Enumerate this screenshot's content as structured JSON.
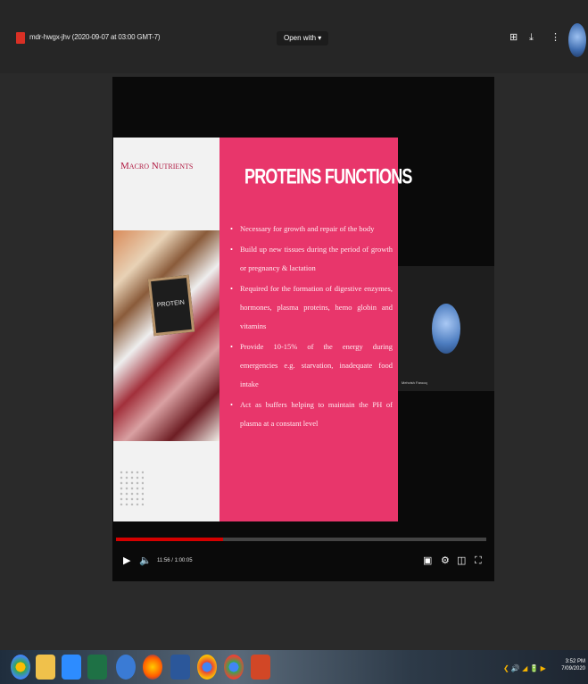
{
  "viewer": {
    "file_title": "mdr-hwgx-jhv (2020-09-07 at 03:00 GMT-7)",
    "open_with_label": "Open with ▾",
    "icons": [
      "add-to-drive-icon",
      "download-icon",
      "more-vert-icon"
    ]
  },
  "slide": {
    "left_title": "Macro Nutrients",
    "photo_sign_text": "PROTEIN",
    "heading": "PROTEINS FUNCTIONS",
    "bullets": [
      "Necessary for growth and repair of the body",
      "Build up new tissues during the period of growth or pregnancy & lactation",
      "Required for the formation of digestive enzymes, hormones, plasma proteins, hemo globin and vitamins",
      "Provide 10-15% of the energy during emergencies e.g. starvation, inadequate food intake",
      "Act as buffers helping to maintain the PH of plasma at a constant level"
    ],
    "colors": {
      "accent": "#e8366b",
      "title": "#b01a42"
    }
  },
  "participant": {
    "name": "Mehvish Farooq"
  },
  "player": {
    "progress_fraction": 0.29,
    "time": "11:56 / 1:00:05",
    "progress_color": "#d50000"
  },
  "taskbar": {
    "apps": [
      "chrome-icon",
      "file-explorer-icon",
      "zoom-icon",
      "excel-icon",
      "edge-icon",
      "firefox-icon",
      "word-icon",
      "chrome-icon",
      "chrome-icon",
      "powerpoint-icon"
    ],
    "tray_text": "❮ 🔊 ◢ 🔋 ▶",
    "clock_time": "3:52 PM",
    "clock_date": "7/09/2020"
  }
}
